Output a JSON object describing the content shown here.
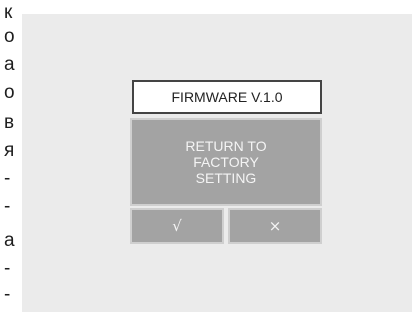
{
  "side_text": {
    "glyphs": [
      "к",
      "о",
      "а",
      "о",
      "в",
      "я",
      "-",
      "-",
      "а",
      "-",
      "-"
    ]
  },
  "dialog": {
    "title": "FIRMWARE V.1.0",
    "message": "RETURN TO FACTORY SETTING",
    "confirm_icon": "check-icon",
    "confirm_glyph": "√",
    "cancel_icon": "close-icon",
    "cancel_glyph": "×"
  },
  "colors": {
    "screen_background": "#ebebeb",
    "panel_fill": "#a3a3a3",
    "panel_border": "#cfcfcf",
    "title_border": "#444444",
    "panel_text": "#f4f4f4"
  }
}
